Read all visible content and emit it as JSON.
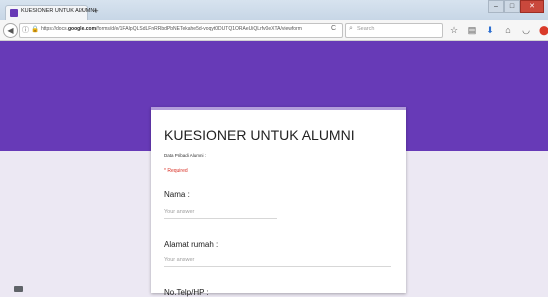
{
  "browser": {
    "tab_title": "KUESIONER UNTUK ALUMNI",
    "tab_close": "×",
    "new_tab": "+",
    "window_buttons": {
      "minimize": "–",
      "maximize": "□",
      "close": "✕"
    },
    "url_prefix": "https://docs.",
    "url_domain": "google.com",
    "url_path": "/forms/d/e/1FAIpQLSdLFnRRbdPbNETekahe5d-voqyt0DUTQ1ORAeUiQLrfv0eXTA/viewform",
    "search_placeholder": "Search",
    "toolbar_icons": [
      "star-icon",
      "bookmarks-icon",
      "download-icon",
      "home-icon",
      "pocket-icon",
      "adblock-icon",
      "menu-icon"
    ]
  },
  "colors": {
    "header": "#673ab7",
    "background": "#ece8f3",
    "accent": "#b39ddb",
    "required": "#d93025"
  },
  "form": {
    "title": "KUESIONER UNTUK ALUMNI",
    "description": "Data Pribadi Alumni :",
    "required_note": "* Required",
    "questions": [
      {
        "label": "Nama :",
        "placeholder": "Your answer"
      },
      {
        "label": "Alamat rumah :",
        "placeholder": "Your answer"
      },
      {
        "label": "No.Telp/HP :"
      }
    ]
  }
}
